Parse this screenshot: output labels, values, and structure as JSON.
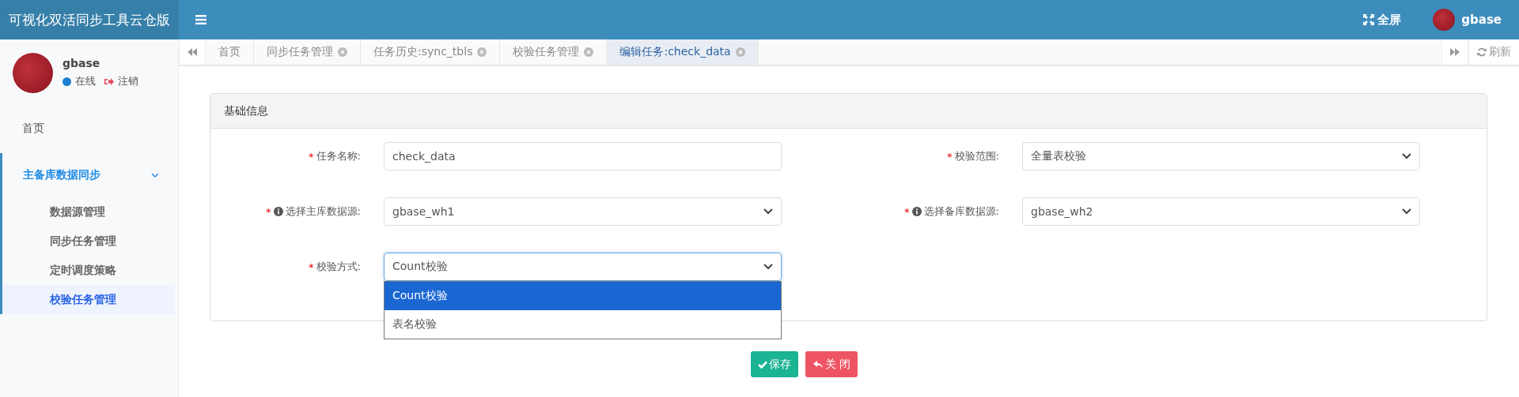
{
  "header": {
    "app_title": "可视化双活同步工具云仓版",
    "fullscreen": "全屏",
    "user_name": "gbase"
  },
  "sidebar": {
    "user": {
      "name": "gbase",
      "status": "在线",
      "logout": "注销"
    },
    "items": [
      {
        "label": "首页",
        "kind": "home"
      },
      {
        "label": "主备库数据同步",
        "kind": "group",
        "expanded": true,
        "children": [
          {
            "label": "数据源管理",
            "selected": false
          },
          {
            "label": "同步任务管理",
            "selected": false
          },
          {
            "label": "定时调度策略",
            "selected": false
          },
          {
            "label": "校验任务管理",
            "selected": true
          }
        ]
      }
    ]
  },
  "tabs": [
    {
      "label": "首页",
      "closable": false,
      "selected": false
    },
    {
      "label": "同步任务管理",
      "closable": true,
      "selected": false
    },
    {
      "label": "任务历史:sync_tbls",
      "closable": true,
      "selected": false
    },
    {
      "label": "校验任务管理",
      "closable": true,
      "selected": false
    },
    {
      "label": "编辑任务:check_data",
      "closable": true,
      "selected": true
    }
  ],
  "refresh": "刷新",
  "panel": {
    "title": "基础信息",
    "fields": [
      {
        "label": "任务名称:",
        "kind": "text",
        "required_mark": "*",
        "info": false,
        "value": "check_data"
      },
      {
        "label": "校验范围:",
        "kind": "select",
        "required_mark": "*",
        "info": false,
        "value": "全量表校验",
        "open": false
      },
      {
        "label": "选择主库数据源:",
        "kind": "select",
        "required_mark": "*",
        "info": true,
        "value": "gbase_wh1",
        "open": false
      },
      {
        "label": "选择备库数据源:",
        "kind": "select",
        "required_mark": "*",
        "info": true,
        "value": "gbase_wh2",
        "open": false
      },
      {
        "label": "校验方式:",
        "kind": "select",
        "required_mark": "*",
        "info": false,
        "value": "Count校验",
        "open": true,
        "options": [
          {
            "label": "Count校验",
            "selected": true
          },
          {
            "label": "表名校验",
            "selected": false
          }
        ]
      }
    ]
  },
  "buttons": [
    {
      "label": "保存",
      "kind": "save"
    },
    {
      "label": "关 闭",
      "kind": "close"
    }
  ]
}
